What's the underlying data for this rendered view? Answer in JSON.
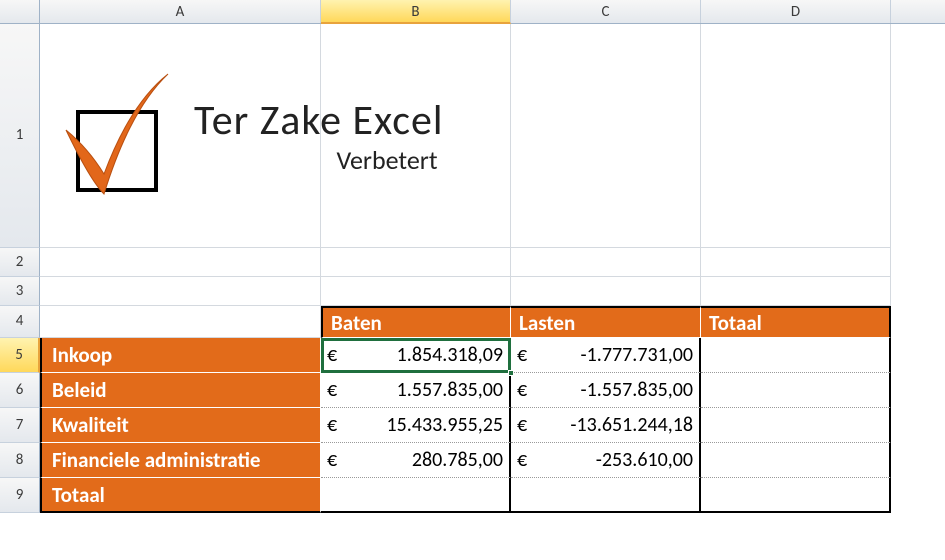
{
  "columns": [
    "A",
    "B",
    "C",
    "D"
  ],
  "row_numbers": [
    1,
    2,
    3,
    4,
    5,
    6,
    7,
    8,
    9
  ],
  "active_cell": "B5",
  "logo": {
    "title": "Ter Zake Excel",
    "subtitle": "Verbetert"
  },
  "table": {
    "headers": {
      "baten": "Baten",
      "lasten": "Lasten",
      "totaal": "Totaal"
    },
    "rows": [
      {
        "label": "Inkoop",
        "baten": "1.854.318,09",
        "lasten": "-1.777.731,00"
      },
      {
        "label": "Beleid",
        "baten": "1.557.835,00",
        "lasten": "-1.557.835,00"
      },
      {
        "label": "Kwaliteit",
        "baten": "15.433.955,25",
        "lasten": "-13.651.244,18"
      },
      {
        "label": "Financiele administratie",
        "baten": "280.785,00",
        "lasten": "-253.610,00"
      }
    ],
    "total_label": "Totaal",
    "currency": "€"
  }
}
